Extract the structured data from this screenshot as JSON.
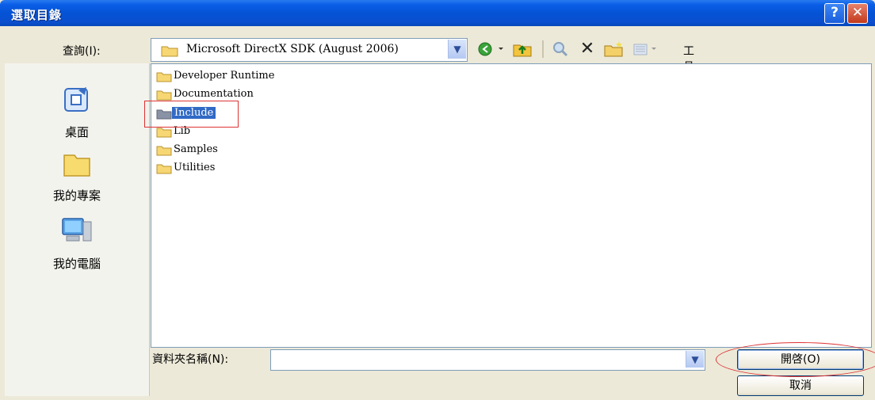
{
  "window": {
    "title": "選取目錄",
    "help_label": "?",
    "close_label": "✕"
  },
  "lookin": {
    "label": "查詢(I):",
    "value": "Microsoft DirectX SDK (August 2006)"
  },
  "toolbar": {
    "tools_label": "工具(L) ▾"
  },
  "places": [
    {
      "label": "桌面",
      "icon": "desktop-icon"
    },
    {
      "label": "我的專案",
      "icon": "folder-icon"
    },
    {
      "label": "我的電腦",
      "icon": "computer-icon"
    }
  ],
  "files": [
    {
      "name": "Developer Runtime"
    },
    {
      "name": "Documentation"
    },
    {
      "name": "Include"
    },
    {
      "name": "Lib"
    },
    {
      "name": "Samples"
    },
    {
      "name": "Utilities"
    }
  ],
  "foldername": {
    "label": "資料夾名稱(N):",
    "value": ""
  },
  "buttons": {
    "open": "開啓(O)",
    "cancel": "取消"
  },
  "colors": {
    "titlebar": "#0553d6",
    "selection": "#316ac5",
    "annotation": "#dd3333"
  }
}
